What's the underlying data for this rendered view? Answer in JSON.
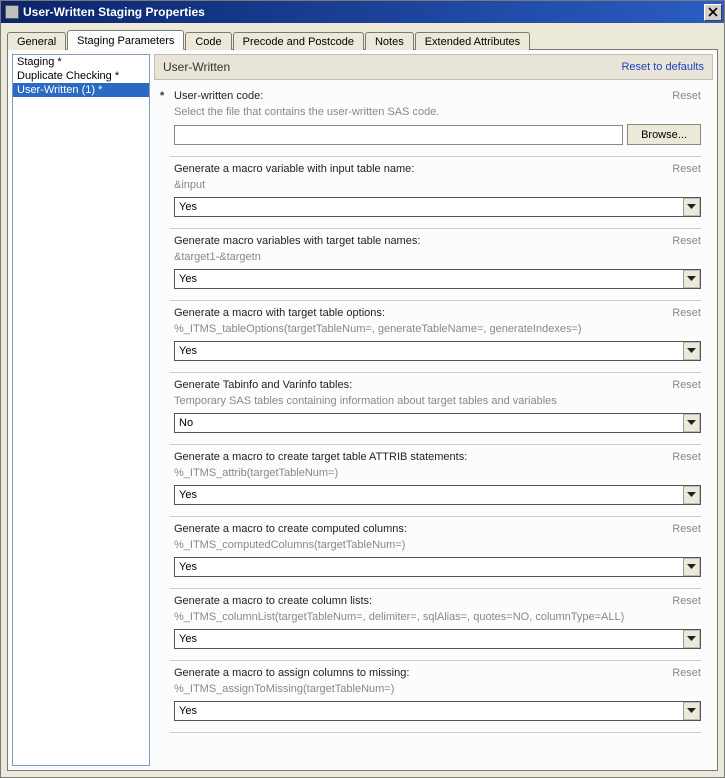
{
  "window": {
    "title": "User-Written Staging Properties"
  },
  "tabs": [
    {
      "label": "General"
    },
    {
      "label": "Staging Parameters"
    },
    {
      "label": "Code"
    },
    {
      "label": "Precode and Postcode"
    },
    {
      "label": "Notes"
    },
    {
      "label": "Extended Attributes"
    }
  ],
  "side_items": [
    {
      "label": "Staging *"
    },
    {
      "label": "Duplicate Checking *"
    },
    {
      "label": "User-Written (1) *"
    }
  ],
  "panel": {
    "title": "User-Written",
    "reset_defaults": "Reset to defaults"
  },
  "labels": {
    "reset": "Reset",
    "browse": "Browse...",
    "yes": "Yes",
    "no": "No"
  },
  "sections": [
    {
      "label": "User-written code:",
      "asterisk": "*",
      "desc": "Select the file that contains the user-written SAS code.",
      "ctrl": "file"
    },
    {
      "label": "Generate a macro variable with input table name:",
      "desc": "&input",
      "ctrl": "select",
      "value": "yes"
    },
    {
      "label": "Generate macro variables with target table names:",
      "desc": "&target1-&targetn",
      "ctrl": "select",
      "value": "yes"
    },
    {
      "label": "Generate a macro with target table options:",
      "desc": "%_ITMS_tableOptions(targetTableNum=, generateTableName=, generateIndexes=)",
      "ctrl": "select",
      "value": "yes"
    },
    {
      "label": "Generate Tabinfo and Varinfo tables:",
      "desc": "Temporary SAS tables containing information about target tables and variables",
      "ctrl": "select",
      "value": "no"
    },
    {
      "label": "Generate a macro to create target table ATTRIB statements:",
      "desc": "%_ITMS_attrib(targetTableNum=)",
      "ctrl": "select",
      "value": "yes"
    },
    {
      "label": "Generate a macro to create computed columns:",
      "desc": "%_ITMS_computedColumns(targetTableNum=)",
      "ctrl": "select",
      "value": "yes"
    },
    {
      "label": "Generate a macro to create column lists:",
      "desc": "%_ITMS_columnList(targetTableNum=, delimiter=, sqlAlias=, quotes=NO, columnType=ALL)",
      "ctrl": "select",
      "value": "yes"
    },
    {
      "label": "Generate a macro to assign columns to missing:",
      "desc": "%_ITMS_assignToMissing(targetTableNum=)",
      "ctrl": "select",
      "value": "yes"
    }
  ]
}
